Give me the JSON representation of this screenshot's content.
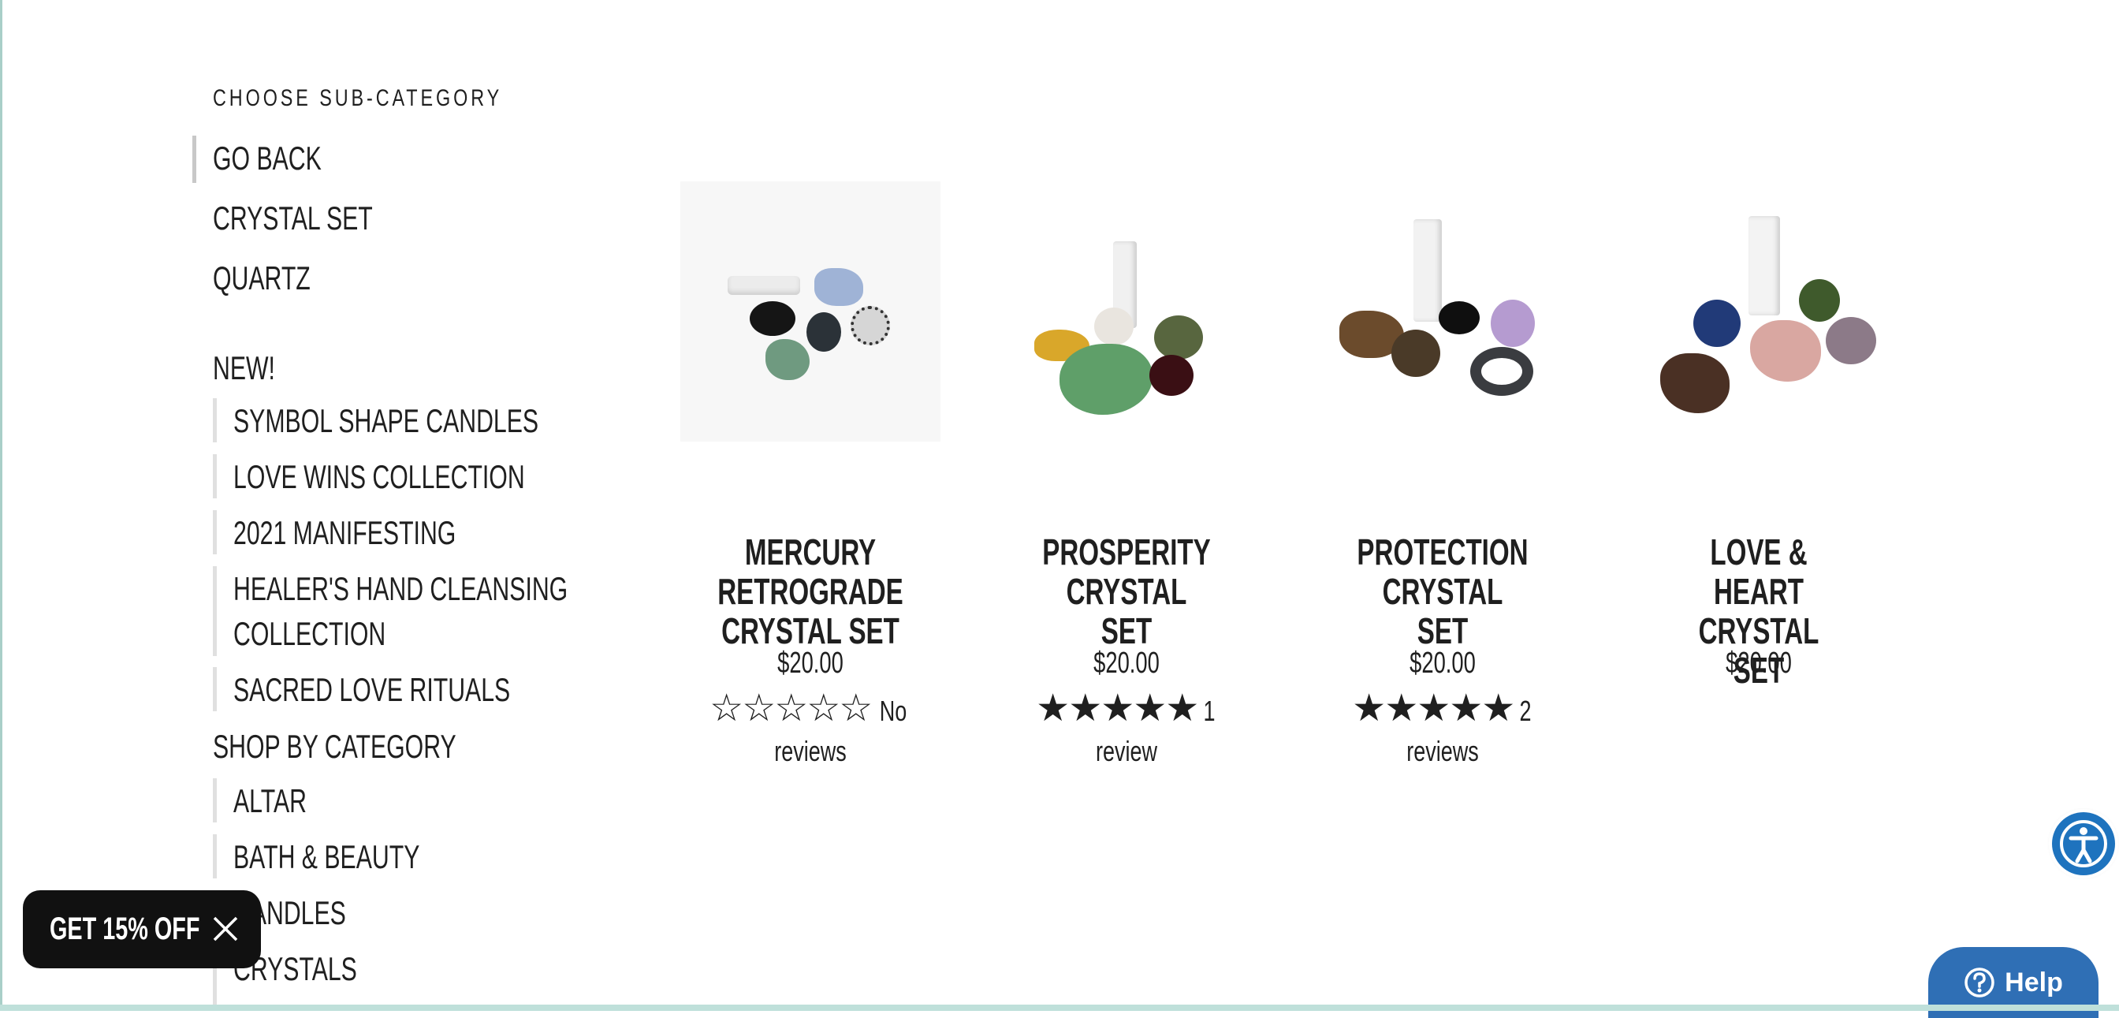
{
  "sidebar": {
    "heading": "CHOOSE SUB-CATEGORY",
    "go_back": "GO BACK",
    "top_items": [
      "CRYSTAL SET",
      "QUARTZ"
    ],
    "new_label": "NEW!",
    "new_items": [
      "SYMBOL SHAPE CANDLES",
      "LOVE WINS COLLECTION",
      "2021 MANIFESTING",
      "HEALER'S HAND CLEANSING",
      "COLLECTION",
      "SACRED LOVE RITUALS"
    ],
    "shop_label": "SHOP BY CATEGORY",
    "shop_items": [
      "ALTAR",
      "BATH & BEAUTY",
      "CANDLES",
      "CRYSTALS"
    ]
  },
  "products": [
    {
      "title_l1": "MERCURY RETROGRADE",
      "title_l2": "CRYSTAL SET",
      "price": "$20.00",
      "rating": 0,
      "rating_text": "No",
      "rating_text2": "reviews"
    },
    {
      "title_l1": "PROSPERITY CRYSTAL",
      "title_l2": "SET",
      "price": "$20.00",
      "rating": 5,
      "rating_text": "1",
      "rating_text2": "review"
    },
    {
      "title_l1": "PROTECTION CRYSTAL",
      "title_l2": "SET",
      "price": "$20.00",
      "rating": 5,
      "rating_text": "2",
      "rating_text2": "reviews"
    },
    {
      "title_l1": "LOVE & HEART CRYSTAL",
      "title_l2": "SET",
      "price": "$20.00",
      "rating": null,
      "rating_text": "",
      "rating_text2": ""
    }
  ],
  "promo": {
    "label": "GET 15% OFF",
    "close_icon": "close-icon"
  },
  "accessibility": {
    "icon": "accessibility-icon"
  },
  "help": {
    "label": "Help",
    "icon": "question-circle-icon"
  }
}
